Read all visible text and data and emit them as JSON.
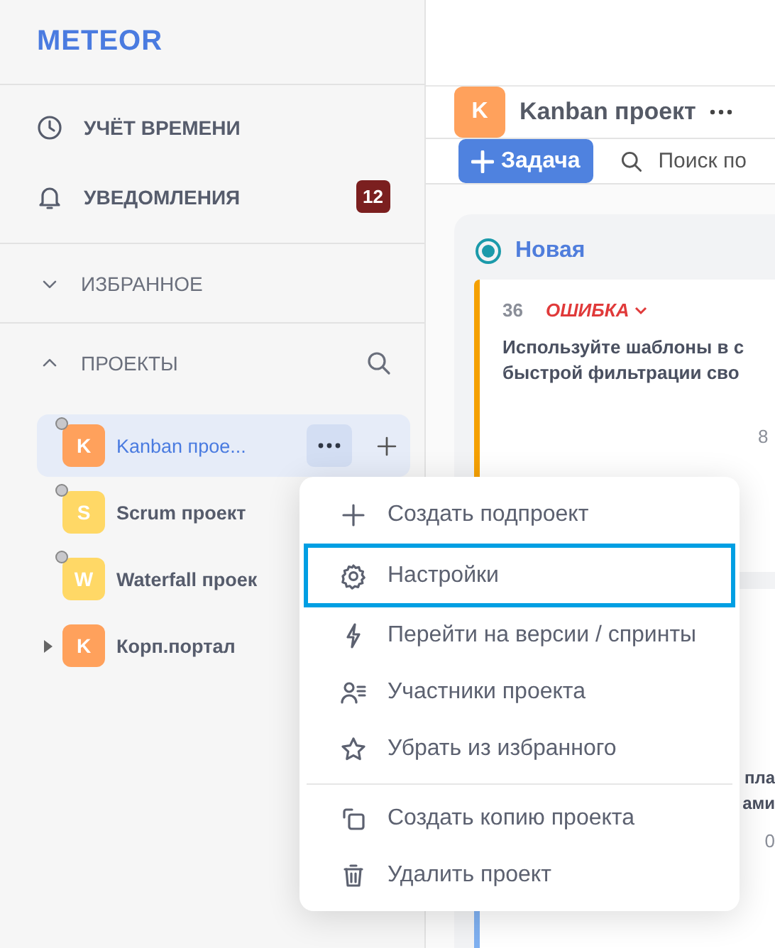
{
  "logo": "METEOR",
  "nav": [
    {
      "label": "УЧЁТ ВРЕМЕНИ"
    },
    {
      "label": "УВЕДОМЛЕНИЯ",
      "badge": "12"
    }
  ],
  "sections": [
    {
      "label": "ИЗБРАННОЕ",
      "expanded": false
    },
    {
      "label": "ПРОЕКТЫ",
      "expanded": true
    }
  ],
  "projects": [
    {
      "letter": "K",
      "name": "Kanban прое...",
      "color": "#ffa15c",
      "selected": true,
      "expandable": false
    },
    {
      "letter": "S",
      "name": "Scrum проект",
      "color": "#ffd866",
      "selected": false,
      "expandable": false
    },
    {
      "letter": "W",
      "name": "Waterfall проек",
      "color": "#ffd866",
      "selected": false,
      "expandable": false
    },
    {
      "letter": "K",
      "name": "Корп.портал",
      "color": "#ffa15c",
      "selected": false,
      "expandable": true
    }
  ],
  "header": {
    "letter": "K",
    "title": "Kanban проект"
  },
  "toolbar": {
    "button": "Задача",
    "search_placeholder": "Поиск по"
  },
  "column": {
    "title": "Новая",
    "cards": [
      {
        "number": "36",
        "type": "ОШИБКА",
        "title": [
          "Используйте шаблоны в с",
          "быстрой фильтрации сво"
        ],
        "count": "8",
        "color": "#f5a000"
      },
      {
        "title": [
          "пла",
          "ами"
        ],
        "count": "0",
        "color": "#7fb0f0"
      }
    ]
  },
  "menu": [
    {
      "label": "Создать подпроект",
      "selected": false
    },
    {
      "label": "Настройки",
      "selected": true
    },
    {
      "label": "Перейти на версии / спринты",
      "selected": false
    },
    {
      "label": "Участники проекта",
      "selected": false
    },
    {
      "label": "Убрать из избранного",
      "selected": false
    },
    {
      "label": "Создать копию проекта",
      "selected": false,
      "divider_before": true
    },
    {
      "label": "Удалить проект",
      "selected": false
    }
  ]
}
